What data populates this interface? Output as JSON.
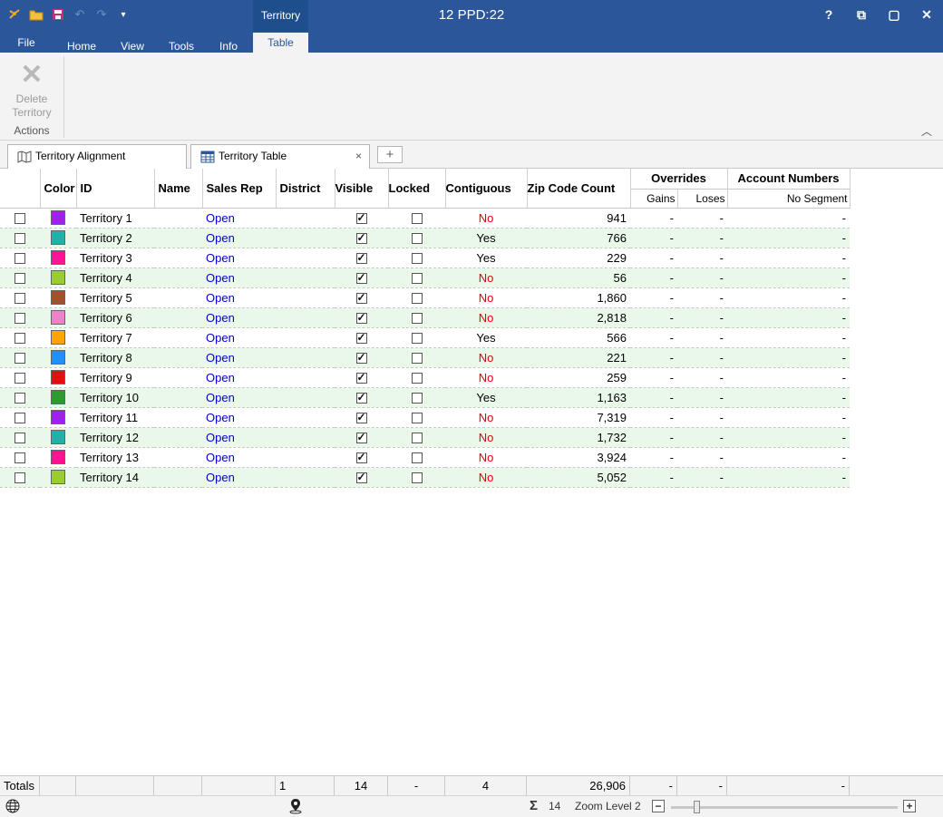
{
  "title_bar": {
    "title": "12 PPD:22",
    "context_group": "Territory",
    "window_buttons": [
      "?",
      "⧉",
      "▢",
      "✕"
    ]
  },
  "ribbon_tabs": [
    "File",
    "Home",
    "View",
    "Tools",
    "Info",
    "Table"
  ],
  "active_tab": "Table",
  "ribbon": {
    "delete_label_1": "Delete",
    "delete_label_2": "Territory",
    "group_label": "Actions"
  },
  "doc_tabs": {
    "tab1": "Territory Alignment",
    "tab2": "Territory Table",
    "close": "×",
    "new": "+"
  },
  "headers": {
    "color": "Color",
    "id": "ID",
    "name": "Name",
    "sales_rep": "Sales Rep",
    "district": "District",
    "visible": "Visible",
    "locked": "Locked",
    "contiguous": "Contiguous",
    "zip_count": "Zip Code Count",
    "overrides": "Overrides",
    "gains": "Gains",
    "loses": "Loses",
    "account_numbers": "Account Numbers",
    "no_segment": "No Segment"
  },
  "rows": [
    {
      "color": "#a020f0",
      "id": "Territory 1",
      "rep": "Open",
      "visible": true,
      "locked": false,
      "contig": "No",
      "zip": "941",
      "gains": "-",
      "loses": "-",
      "acct": "-"
    },
    {
      "color": "#20b2aa",
      "id": "Territory 2",
      "rep": "Open",
      "visible": true,
      "locked": false,
      "contig": "Yes",
      "zip": "766",
      "gains": "-",
      "loses": "-",
      "acct": "-"
    },
    {
      "color": "#ff1493",
      "id": "Territory 3",
      "rep": "Open",
      "visible": true,
      "locked": false,
      "contig": "Yes",
      "zip": "229",
      "gains": "-",
      "loses": "-",
      "acct": "-"
    },
    {
      "color": "#9acd32",
      "id": "Territory 4",
      "rep": "Open",
      "visible": true,
      "locked": false,
      "contig": "No",
      "zip": "56",
      "gains": "-",
      "loses": "-",
      "acct": "-"
    },
    {
      "color": "#a0522d",
      "id": "Territory 5",
      "rep": "Open",
      "visible": true,
      "locked": false,
      "contig": "No",
      "zip": "1,860",
      "gains": "-",
      "loses": "-",
      "acct": "-"
    },
    {
      "color": "#ee82c8",
      "id": "Territory 6",
      "rep": "Open",
      "visible": true,
      "locked": false,
      "contig": "No",
      "zip": "2,818",
      "gains": "-",
      "loses": "-",
      "acct": "-"
    },
    {
      "color": "#ffa500",
      "id": "Territory 7",
      "rep": "Open",
      "visible": true,
      "locked": false,
      "contig": "Yes",
      "zip": "566",
      "gains": "-",
      "loses": "-",
      "acct": "-"
    },
    {
      "color": "#1e90ff",
      "id": "Territory 8",
      "rep": "Open",
      "visible": true,
      "locked": false,
      "contig": "No",
      "zip": "221",
      "gains": "-",
      "loses": "-",
      "acct": "-"
    },
    {
      "color": "#e01010",
      "id": "Territory 9",
      "rep": "Open",
      "visible": true,
      "locked": false,
      "contig": "No",
      "zip": "259",
      "gains": "-",
      "loses": "-",
      "acct": "-"
    },
    {
      "color": "#2e9b2e",
      "id": "Territory 10",
      "rep": "Open",
      "visible": true,
      "locked": false,
      "contig": "Yes",
      "zip": "1,163",
      "gains": "-",
      "loses": "-",
      "acct": "-"
    },
    {
      "color": "#a020f0",
      "id": "Territory 11",
      "rep": "Open",
      "visible": true,
      "locked": false,
      "contig": "No",
      "zip": "7,319",
      "gains": "-",
      "loses": "-",
      "acct": "-"
    },
    {
      "color": "#20b2aa",
      "id": "Territory 12",
      "rep": "Open",
      "visible": true,
      "locked": false,
      "contig": "No",
      "zip": "1,732",
      "gains": "-",
      "loses": "-",
      "acct": "-"
    },
    {
      "color": "#ff1493",
      "id": "Territory 13",
      "rep": "Open",
      "visible": true,
      "locked": false,
      "contig": "No",
      "zip": "3,924",
      "gains": "-",
      "loses": "-",
      "acct": "-"
    },
    {
      "color": "#9acd32",
      "id": "Territory 14",
      "rep": "Open",
      "visible": true,
      "locked": false,
      "contig": "No",
      "zip": "5,052",
      "gains": "-",
      "loses": "-",
      "acct": "-"
    }
  ],
  "totals": {
    "label": "Totals",
    "district": "1",
    "visible": "14",
    "locked": "-",
    "contiguous": "4",
    "zip": "26,906",
    "gains": "-",
    "loses": "-",
    "acct": "-"
  },
  "status": {
    "count": "14",
    "zoom_label": "Zoom Level 2",
    "zoom_minus": "−",
    "zoom_plus": "+",
    "zoom_fraction": 0.1
  },
  "colors": {
    "title_bar": "#2b579a",
    "row_alt": "#eaf8ea",
    "open_link": "#0000cc",
    "no_text": "#e00000"
  }
}
